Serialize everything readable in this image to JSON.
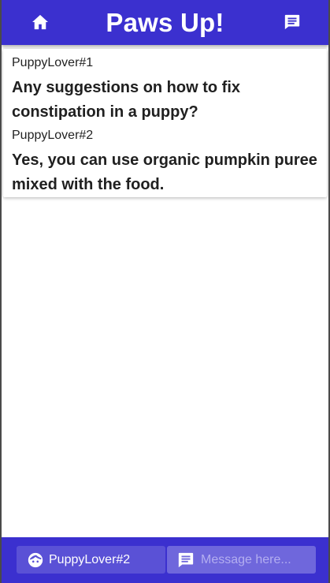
{
  "header": {
    "title": "Paws Up!",
    "home_icon": "home-icon",
    "chat_icon": "chat-icon"
  },
  "messages": [
    {
      "author": "PuppyLover#1",
      "text": "Any suggestions on how to fix constipation in a puppy?"
    },
    {
      "author": "PuppyLover#2",
      "text": "Yes, you can use organic pumpkin puree mixed with the food."
    }
  ],
  "footer": {
    "user_icon": "face-icon",
    "username": "PuppyLover#2",
    "message_icon": "message-icon",
    "message_placeholder": "Message here...",
    "message_value": ""
  },
  "colors": {
    "primary": "#3b30cf",
    "chip": "#5a51d6",
    "input": "#6f67dc"
  }
}
